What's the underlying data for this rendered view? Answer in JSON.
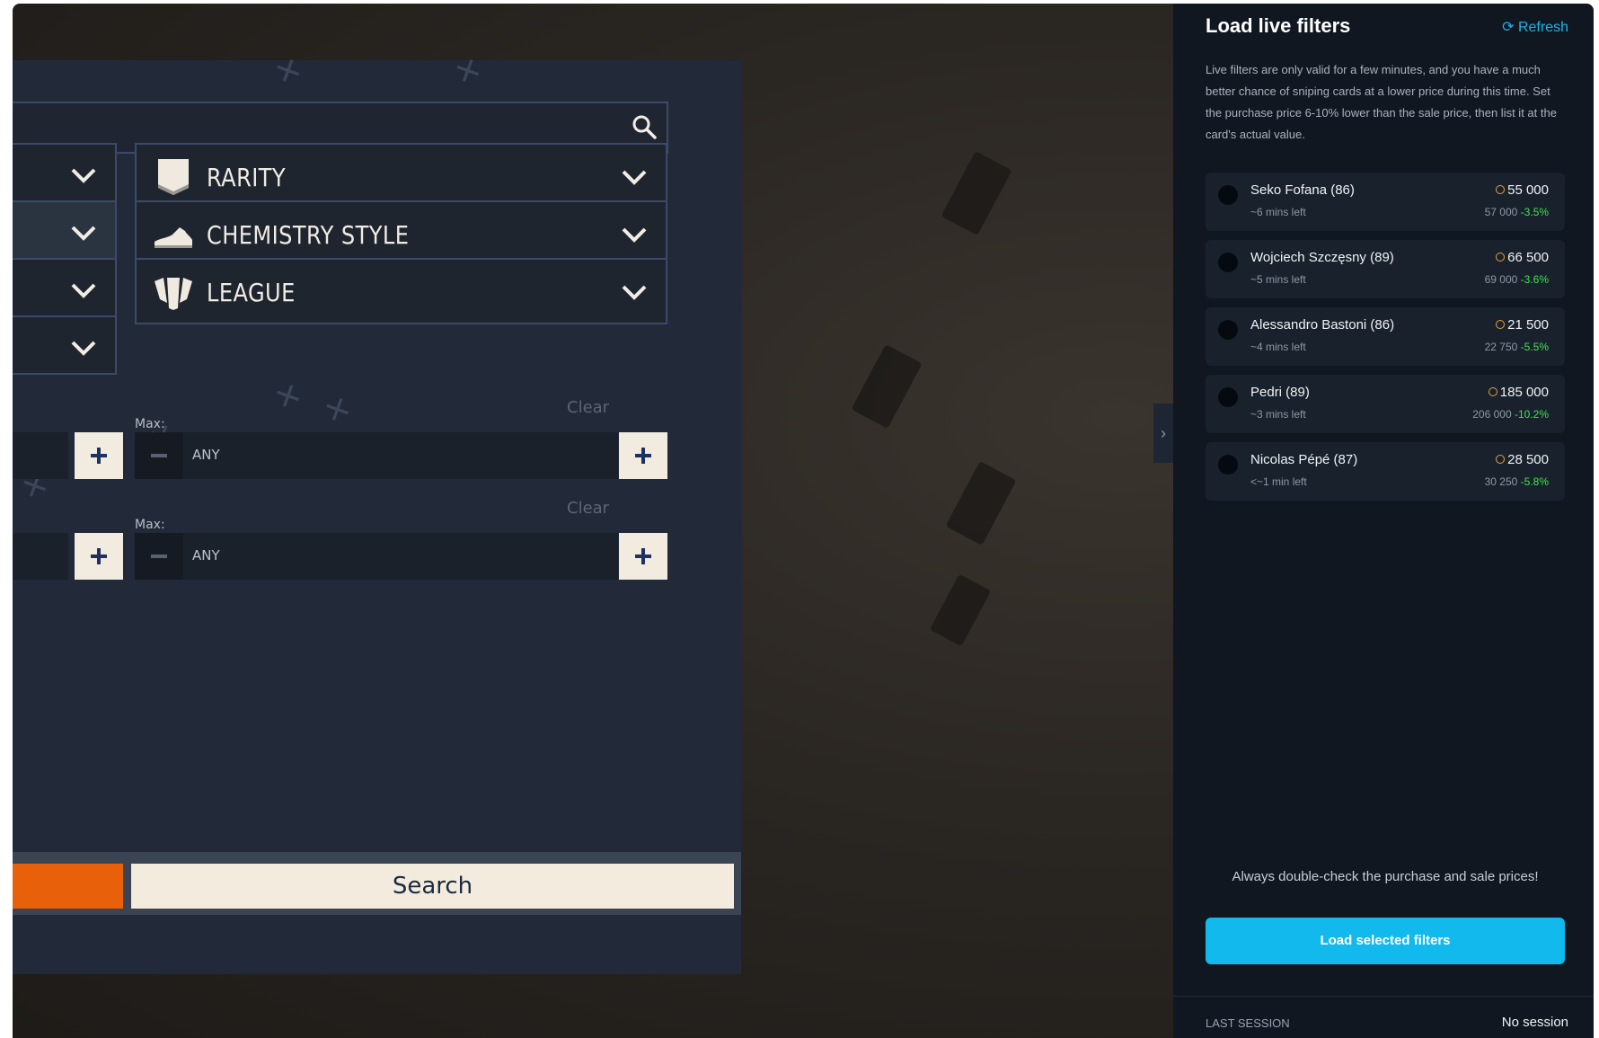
{
  "panel": {
    "filters": [
      {
        "label": "RARITY",
        "icon": "rarity-badge-icon"
      },
      {
        "label": "CHEMISTRY STYLE",
        "icon": "boot-icon"
      },
      {
        "label": "LEAGUE",
        "icon": "league-shield-icon"
      }
    ],
    "price_rows": [
      {
        "clear": "Clear",
        "max_label": "Max:",
        "value": "ANY"
      },
      {
        "clear": "Clear",
        "max_label": "Max:",
        "value": "ANY"
      }
    ],
    "search_button": "Search",
    "accent": "#e8600a"
  },
  "sidebar": {
    "title": "Load live filters",
    "refresh": "Refresh",
    "description": "Live filters are only valid for a few minutes, and you have a much better chance of sniping cards at a lower price during this time. Set the purchase price 6-10% lower than the sale price, then list it at the card's actual value.",
    "items": [
      {
        "name": "Seko Fofana (86)",
        "time": "~6 mins left",
        "price": "55 000",
        "sale": "57 000",
        "pct": "-3.5%"
      },
      {
        "name": "Wojciech Szczęsny (89)",
        "time": "~5 mins left",
        "price": "66 500",
        "sale": "69 000",
        "pct": "-3.6%"
      },
      {
        "name": "Alessandro Bastoni (86)",
        "time": "~4 mins left",
        "price": "21 500",
        "sale": "22 750",
        "pct": "-5.5%"
      },
      {
        "name": "Pedri (89)",
        "time": "~3 mins left",
        "price": "185 000",
        "sale": "206 000",
        "pct": "-10.2%"
      },
      {
        "name": "Nicolas Pépé (87)",
        "time": "<~1 min left",
        "price": "28 500",
        "sale": "30 250",
        "pct": "-5.8%"
      }
    ],
    "warning": "Always double-check the purchase and sale prices!",
    "load_button": "Load selected filters",
    "last_session_label": "LAST SESSION",
    "last_session_value": "No session",
    "accent": "#12b9ec",
    "positive_color": "#3fe34d"
  }
}
